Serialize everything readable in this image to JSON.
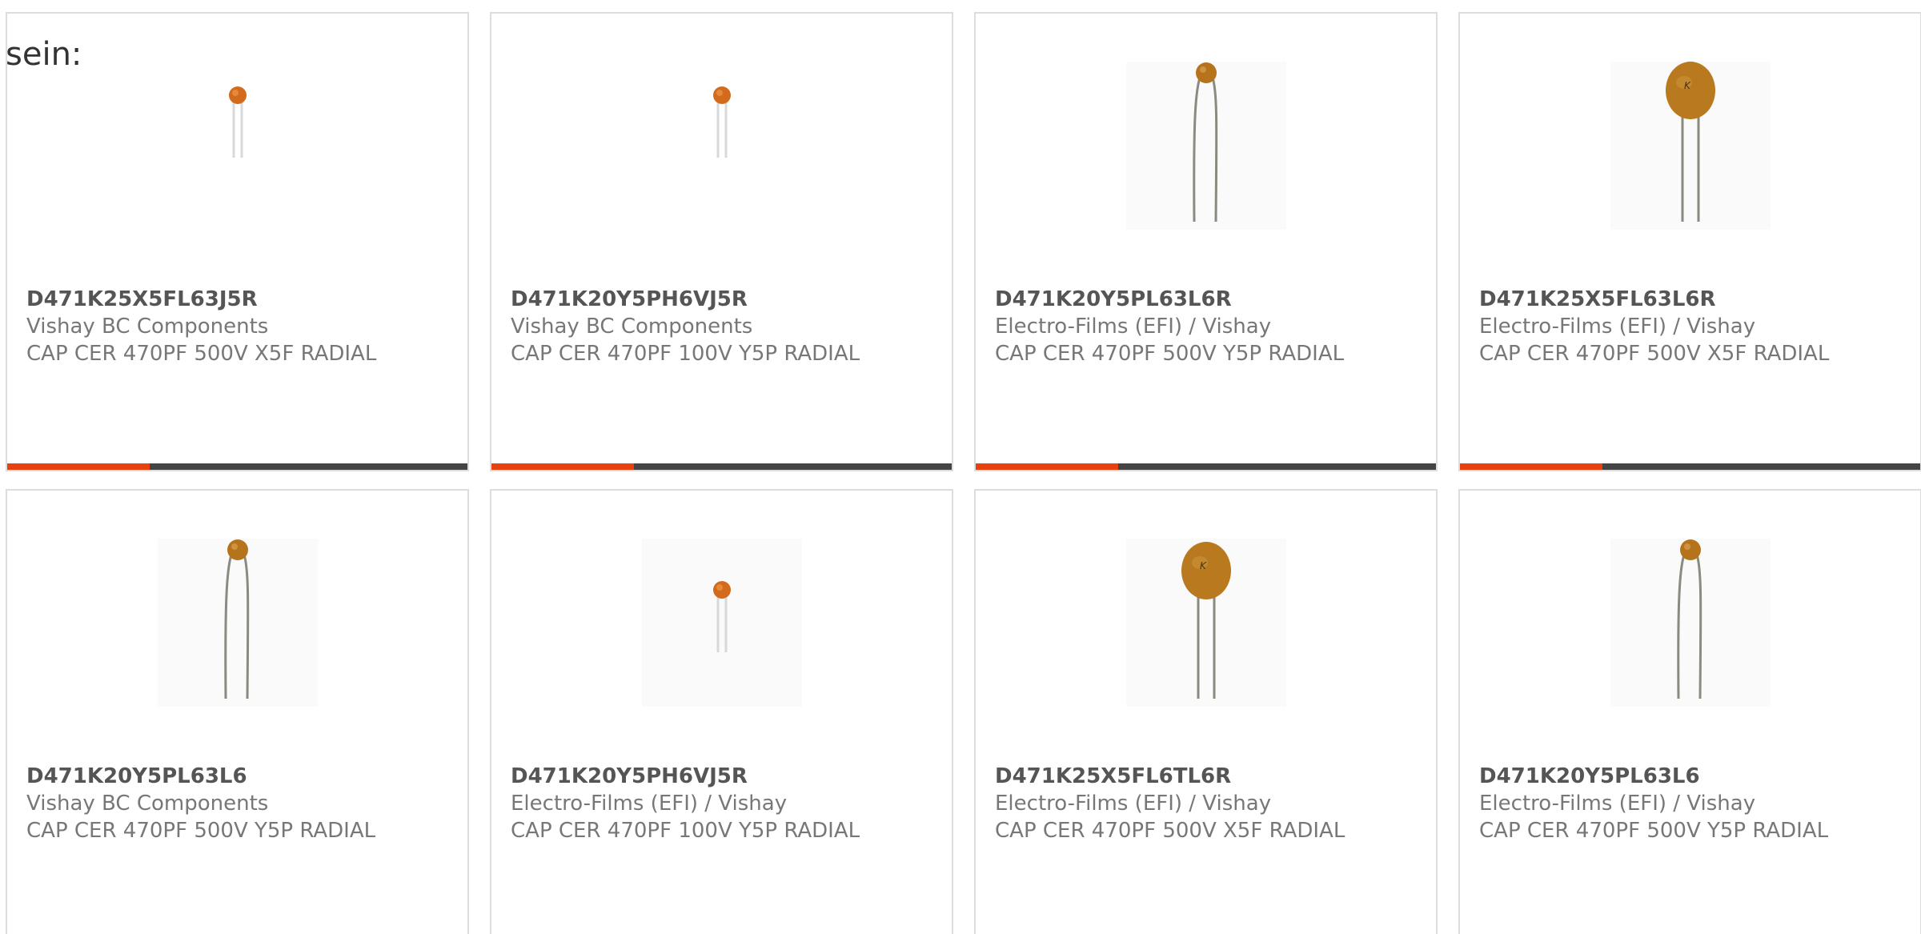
{
  "intro_text": "sein:",
  "colors": {
    "accent": "#e8410f",
    "bar_track": "#444444",
    "card_border": "#dddddd"
  },
  "cards": [
    {
      "part_number": "D471K25X5FL63J5R",
      "manufacturer": "Vishay BC Components",
      "description": "CAP CER 470PF 500V X5F RADIAL",
      "image": "small-orange-ceramic-capacitor",
      "progress": 0.31
    },
    {
      "part_number": "D471K20Y5PH6VJ5R",
      "manufacturer": "Vishay BC Components",
      "description": "CAP CER 470PF 100V Y5P RADIAL",
      "image": "small-orange-ceramic-capacitor",
      "progress": 0.31
    },
    {
      "part_number": "D471K20Y5PL63L6R",
      "manufacturer": "Electro-Films (EFI) / Vishay",
      "description": "CAP CER 470PF 500V Y5P RADIAL",
      "image": "small-brown-ceramic-capacitor-long-leads",
      "progress": 0.31
    },
    {
      "part_number": "D471K25X5FL63L6R",
      "manufacturer": "Electro-Films (EFI) / Vishay",
      "description": "CAP CER 470PF 500V X5F RADIAL",
      "image": "large-brown-disc-capacitor",
      "progress": 0.31
    },
    {
      "part_number": "D471K20Y5PL63L6",
      "manufacturer": "Vishay BC Components",
      "description": "CAP CER 470PF 500V Y5P RADIAL",
      "image": "small-brown-ceramic-capacitor-long-leads"
    },
    {
      "part_number": "D471K20Y5PH6VJ5R",
      "manufacturer": "Electro-Films (EFI) / Vishay",
      "description": "CAP CER 470PF 100V Y5P RADIAL",
      "image": "small-orange-ceramic-capacitor"
    },
    {
      "part_number": "D471K25X5FL6TL6R",
      "manufacturer": "Electro-Films (EFI) / Vishay",
      "description": "CAP CER 470PF 500V X5F RADIAL",
      "image": "large-brown-disc-capacitor"
    },
    {
      "part_number": "D471K20Y5PL63L6",
      "manufacturer": "Electro-Films (EFI) / Vishay",
      "description": "CAP CER 470PF 500V Y5P RADIAL",
      "image": "small-brown-ceramic-capacitor-long-leads"
    }
  ]
}
